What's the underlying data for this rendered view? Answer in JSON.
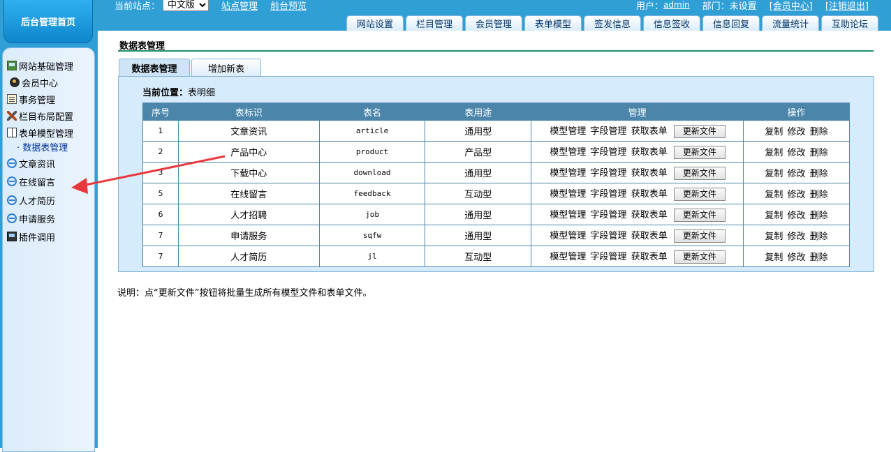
{
  "sidebar": {
    "home": "后台管理首页",
    "items": [
      {
        "label": "网站基础管理",
        "icon": "site-icon"
      },
      {
        "label": "会员中心",
        "icon": "member-icon"
      },
      {
        "label": "事务管理",
        "icon": "task-icon"
      },
      {
        "label": "栏目布局配置",
        "icon": "tools-icon"
      },
      {
        "label": "表单模型管理",
        "icon": "book-icon"
      },
      {
        "label": "数据表管理",
        "icon": ""
      },
      {
        "label": "文章资讯",
        "icon": "ie-icon"
      },
      {
        "label": "在线留言",
        "icon": "ie-icon"
      },
      {
        "label": "人才简历",
        "icon": "ie-icon"
      },
      {
        "label": "申请服务",
        "icon": "ie-icon"
      },
      {
        "label": "插件调用",
        "icon": "plugin-icon"
      }
    ]
  },
  "topbar": {
    "site_label": "当前站点：",
    "site_value": "中文版",
    "links": [
      "站点管理",
      "前台预览"
    ],
    "user_label": "用户：",
    "user_name": "admin",
    "dept": "部门：未设置",
    "member_center": "[会员中心]",
    "logout": "[注销退出]"
  },
  "main_tabs": [
    "网站设置",
    "栏目管理",
    "会员管理",
    "表单模型",
    "签发信息",
    "信息签收",
    "信息回复",
    "流量统计",
    "互助论坛"
  ],
  "page": {
    "title": "数据表管理",
    "tabs": [
      "数据表管理",
      "增加新表"
    ],
    "location_label": "当前位置：",
    "location_value": "表明细",
    "note": "说明：点“更新文件”按钮将批量生成所有模型文件和表单文件。"
  },
  "table": {
    "headers": [
      "序号",
      "表标识",
      "表名",
      "表用途",
      "管理",
      "操作"
    ],
    "manage_links": [
      "模型管理",
      "字段管理",
      "获取表单"
    ],
    "update_button": "更新文件",
    "ops": [
      "复制",
      "修改",
      "删除"
    ],
    "rows": [
      {
        "seq": "1",
        "label": "文章资讯",
        "name": "article",
        "usage": "通用型"
      },
      {
        "seq": "2",
        "label": "产品中心",
        "name": "product",
        "usage": "产品型"
      },
      {
        "seq": "3",
        "label": "下载中心",
        "name": "download",
        "usage": "通用型"
      },
      {
        "seq": "5",
        "label": "在线留言",
        "name": "feedback",
        "usage": "互动型"
      },
      {
        "seq": "6",
        "label": "人才招聘",
        "name": "job",
        "usage": "通用型"
      },
      {
        "seq": "7",
        "label": "申请服务",
        "name": "sqfw",
        "usage": "通用型"
      },
      {
        "seq": "7",
        "label": "人才简历",
        "name": "jl",
        "usage": "互动型"
      }
    ]
  },
  "colors": {
    "topbar": "#2f9fd6",
    "table_header": "#4b86aa",
    "panel": "#d6ebfb",
    "annotation_arrow": "#e8383d"
  }
}
